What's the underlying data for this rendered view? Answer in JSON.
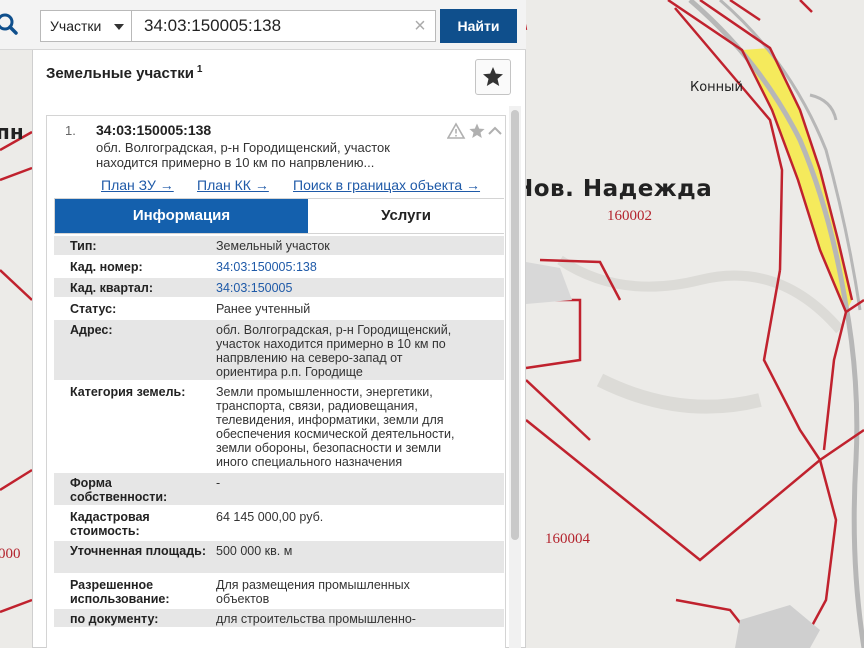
{
  "search": {
    "scope_label": "Участки",
    "query_value": "34:03:150005:138",
    "clear_symbol": "×",
    "find_label": "Найти"
  },
  "panel": {
    "title": "Земельные участки",
    "title_count": "1"
  },
  "result": {
    "number": "1.",
    "cad_number": "34:03:150005:138",
    "address_line1": "обл. Волгоградская, р-н Городищенский, участок",
    "address_line2": "находится примерно в 10 км по напрвлению...",
    "links": [
      "План ЗУ →",
      "План КК →",
      "Поиск в границах объекта →"
    ]
  },
  "tabs": {
    "info": "Информация",
    "services": "Услуги"
  },
  "properties": [
    {
      "label": "Тип:",
      "value": [
        "Земельный участок"
      ],
      "link": false
    },
    {
      "label": "Кад. номер:",
      "value": [
        "34:03:150005:138"
      ],
      "link": true
    },
    {
      "label": "Кад. квартал:",
      "value": [
        "34:03:150005"
      ],
      "link": true
    },
    {
      "label": "Статус:",
      "value": [
        "Ранее учтенный"
      ],
      "link": false
    },
    {
      "label": "Адрес:",
      "value": [
        "обл. Волгоградская, р-н Городищенский,",
        "участок находится примерно в 10 км по",
        "напрвлению на северо-запад от",
        "ориентира р.п. Городище"
      ],
      "link": false
    },
    {
      "label": "Категория земель:",
      "value": [
        "Земли промышленности, энергетики,",
        "транспорта, связи, радиовещания,",
        "телевидения, информатики, земли для",
        "обеспечения космической деятельности,",
        "земли обороны, безопасности и земли",
        "иного специального назначения"
      ],
      "link": false
    },
    {
      "label": "Форма собственности:",
      "value": [
        "-"
      ],
      "link": false
    },
    {
      "label": "Кадастровая стоимость:",
      "value": [
        "64 145 000,00 руб."
      ],
      "link": false
    },
    {
      "label": "Уточненная площадь:",
      "value": [
        "500 000 кв. м"
      ],
      "link": false
    },
    {
      "label": "Разрешенное использование:",
      "value": [
        "Для размещения промышленных",
        "объектов"
      ],
      "link": false
    },
    {
      "label": "по документу:",
      "value": [
        "для строительства промышленно-"
      ],
      "link": false
    }
  ],
  "map": {
    "labels": [
      "Конный",
      "Нов. Надежда",
      "пн",
      "000"
    ],
    "codes": [
      "160002",
      "160004"
    ]
  },
  "colors": {
    "accent": "#0f4f8c",
    "tab_active": "#1460ad",
    "link": "#1f5aa8",
    "boundary": "#c0222e",
    "highlight": "#f5ea5c"
  }
}
